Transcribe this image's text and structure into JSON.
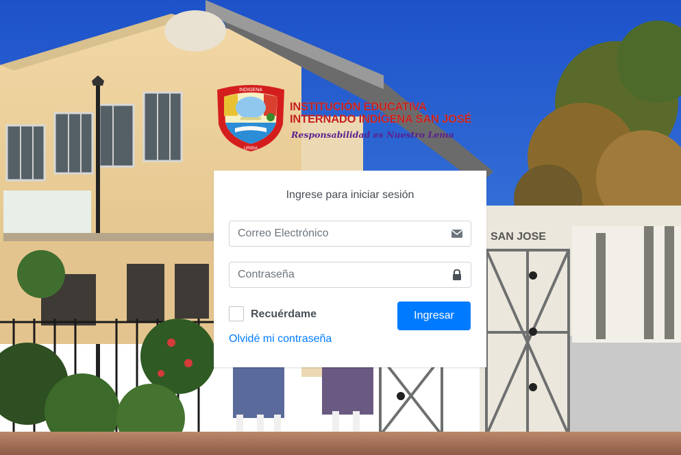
{
  "background": {
    "description_icon": "school-building-photo",
    "sign_text": "SAN JOSE"
  },
  "logo": {
    "line1": "INSTITUCIÓN EDUCATIVA",
    "line2": "INTERNADO INDÍGENA SAN JOSÉ",
    "slogan": "Responsabilidad es Nuestro Lema",
    "badge_top": "INDIGENA",
    "badge_bottom": "URIBIA"
  },
  "login": {
    "title": "Ingrese para iniciar sesión",
    "email_placeholder": "Correo Electrónico",
    "email_icon": "envelope-icon",
    "password_placeholder": "Contraseña",
    "password_icon": "lock-icon",
    "remember_label": "Recuérdame",
    "submit_label": "Ingresar",
    "forgot_label": "Olvidé mi contraseña"
  },
  "colors": {
    "primary": "#007bff",
    "brand_red": "#c41f1b",
    "brand_purple": "#5a1f8f"
  }
}
